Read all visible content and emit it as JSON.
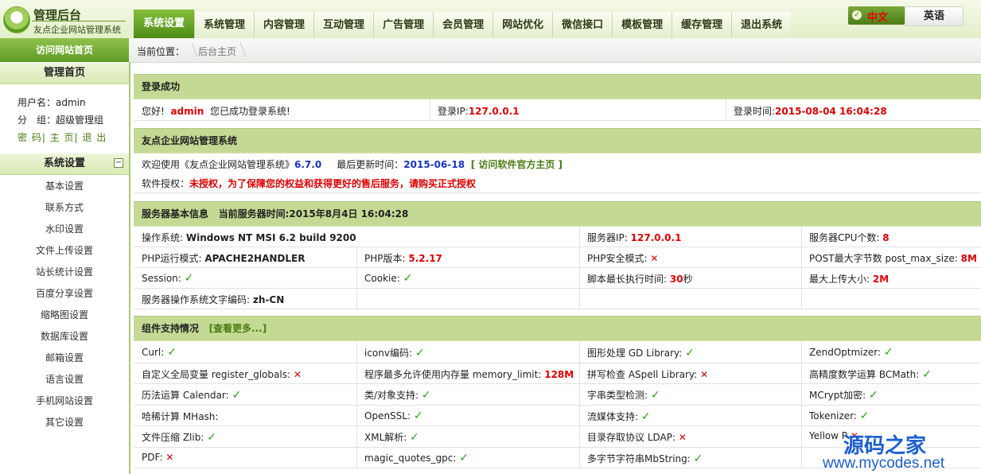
{
  "app": {
    "title": "管理后台",
    "subtitle": "友点企业网站管理系统"
  },
  "nav": {
    "tabs": [
      "系统设置",
      "系统管理",
      "内容管理",
      "互动管理",
      "广告管理",
      "会员管理",
      "网站优化",
      "微信接口",
      "模板管理",
      "缓存管理",
      "退出系统"
    ],
    "active_index": 0
  },
  "lang": {
    "chinese": "中文",
    "english": "英语",
    "check": "✓"
  },
  "sidebar": {
    "visit_home": "访问网站首页",
    "manage_home": "管理首页",
    "username_label": "用户名：admin",
    "group_label": "分　组：超级管理组",
    "links": [
      "密 码",
      "主 页",
      "退 出"
    ],
    "link_sep": "|",
    "section_title": "系统设置",
    "collapse": "−",
    "items": [
      "基本设置",
      "联系方式",
      "水印设置",
      "文件上传设置",
      "站长统计设置",
      "百度分享设置",
      "缩略图设置",
      "数据库设置",
      "邮箱设置",
      "语言设置",
      "手机网站设置",
      "其它设置"
    ]
  },
  "breadcrumb": {
    "label": "当前位置：",
    "item": "后台主页"
  },
  "login": {
    "title": "登录成功",
    "hello": "您好!",
    "user": "admin",
    "msg": "您已成功登录系统!",
    "ip_label": "登录IP:",
    "ip": "127.0.0.1",
    "time_label": "登录时间:",
    "time": "2015-08-04 16:04:28"
  },
  "system": {
    "title": "友点企业网站管理系统",
    "welcome": "欢迎使用《友点企业网站管理系统》",
    "version": "6.7.0",
    "updated_label": "最后更新时间：",
    "updated": "2015-06-18",
    "official_link": "[ 访问软件官方主页 ]",
    "license_label": "软件授权：",
    "license": "未授权，为了保障您的权益和获得更好的售后服务，请购买正式授权"
  },
  "server": {
    "title": "服务器基本信息",
    "time_label": "当前服务器时间:2015年8月4日 16:04:28",
    "rows": [
      [
        {
          "label": "操作系统:",
          "value": "Windows NT MSI 6.2 build 9200",
          "style": "bold"
        },
        {
          "label": "服务器IP:",
          "value": "127.0.0.1",
          "style": "red"
        },
        {
          "label": "服务器CPU个数:",
          "value": "8",
          "style": "red"
        }
      ],
      [
        {
          "label": "PHP运行模式:",
          "value": "APACHE2HANDLER",
          "style": "bold"
        },
        {
          "label": "PHP版本:",
          "value": "5.2.17",
          "style": "red"
        },
        {
          "label": "PHP安全模式:",
          "value": "✕",
          "style": "no"
        },
        {
          "label": "POST最大字节数 post_max_size:",
          "value": "8M",
          "style": "red"
        }
      ],
      [
        {
          "label": "Session:",
          "value": "✓",
          "style": "ok"
        },
        {
          "label": "Cookie:",
          "value": "✓",
          "style": "ok"
        },
        {
          "label": "脚本最长执行时间:",
          "value": "30",
          "suffix": "秒",
          "style": "red"
        },
        {
          "label": "最大上传大小:",
          "value": "2M",
          "style": "red"
        }
      ],
      [
        {
          "label": "服务器操作系统文字编码:",
          "value": "zh-CN",
          "style": "bold"
        }
      ]
    ]
  },
  "components": {
    "title": "组件支持情况",
    "more": "[查看更多...]",
    "rows": [
      [
        {
          "label": "Curl:",
          "value": "✓",
          "style": "ok"
        },
        {
          "label": "iconv编码:",
          "value": "✓",
          "style": "ok"
        },
        {
          "label": "图形处理 GD Library:",
          "value": "✓",
          "style": "ok"
        },
        {
          "label": "ZendOptmizer:",
          "value": "✓",
          "style": "ok"
        }
      ],
      [
        {
          "label": "自定义全局变量 register_globals:",
          "value": "✕",
          "style": "no"
        },
        {
          "label": "程序最多允许使用内存量 memory_limit:",
          "value": "128M",
          "style": "red"
        },
        {
          "label": "拼写检查 ASpell Library:",
          "value": "✕",
          "style": "no"
        },
        {
          "label": "高精度数学运算 BCMath:",
          "value": "✓",
          "style": "ok"
        }
      ],
      [
        {
          "label": "历法运算 Calendar:",
          "value": "✓",
          "style": "ok"
        },
        {
          "label": "类/对象支持:",
          "value": "✓",
          "style": "ok"
        },
        {
          "label": "字串类型检测:",
          "value": "✓",
          "style": "ok"
        },
        {
          "label": "MCrypt加密:",
          "value": "✓",
          "style": "ok"
        }
      ],
      [
        {
          "label": "哈稀计算 MHash:",
          "value": "",
          "style": "ok"
        },
        {
          "label": "OpenSSL:",
          "value": "✓",
          "style": "ok"
        },
        {
          "label": "流媒体支持:",
          "value": "✓",
          "style": "ok"
        },
        {
          "label": "Tokenizer:",
          "value": "✓",
          "style": "ok"
        }
      ],
      [
        {
          "label": "文件压缩 Zlib:",
          "value": "✓",
          "style": "ok"
        },
        {
          "label": "XML解析:",
          "value": "✓",
          "style": "ok"
        },
        {
          "label": "目录存取协议 LDAP:",
          "value": "✕",
          "style": "no"
        },
        {
          "label": "Yellow P",
          "value": "✕",
          "style": "no"
        }
      ],
      [
        {
          "label": "PDF:",
          "value": "✕",
          "style": "no"
        },
        {
          "label": "magic_quotes_gpc:",
          "value": "✓",
          "style": "ok"
        },
        {
          "label": "多字节字符串MbString:",
          "value": "✓",
          "style": "ok"
        }
      ]
    ]
  },
  "watermark": {
    "line1": "源码之家",
    "line2": "www.mycodes.net"
  }
}
